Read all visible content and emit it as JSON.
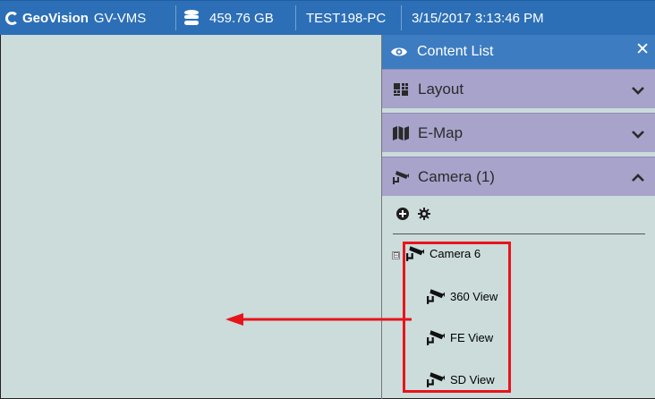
{
  "topbar": {
    "brand_logo": "GeoVision",
    "app_name": "GV-VMS",
    "disk_space": "459.76 GB",
    "host_name": "TEST198-PC",
    "datetime": "3/15/2017 3:13:46 PM"
  },
  "content_list": {
    "title": "Content List",
    "close_glyph": "✕",
    "sections": [
      {
        "label": "Layout",
        "icon": "layout-icon",
        "state": "collapsed"
      },
      {
        "label": "E-Map",
        "icon": "map-icon",
        "state": "collapsed"
      },
      {
        "label": "Camera (1)",
        "icon": "camera-icon",
        "state": "expanded"
      }
    ],
    "tools": {
      "add_icon": "plus-circle-icon",
      "settings_icon": "gear-icon"
    },
    "tree": {
      "root": {
        "label": "Camera 6",
        "expander": "⊟"
      },
      "children": [
        {
          "label": "360 View"
        },
        {
          "label": "FE View"
        },
        {
          "label": "SD View"
        }
      ]
    }
  },
  "colors": {
    "topbar": "#2c6fb7",
    "panel_header": "#3d7cc0",
    "section": "#a7a3cb",
    "workspace": "#cbdcdb",
    "highlight": "#e8141b"
  }
}
